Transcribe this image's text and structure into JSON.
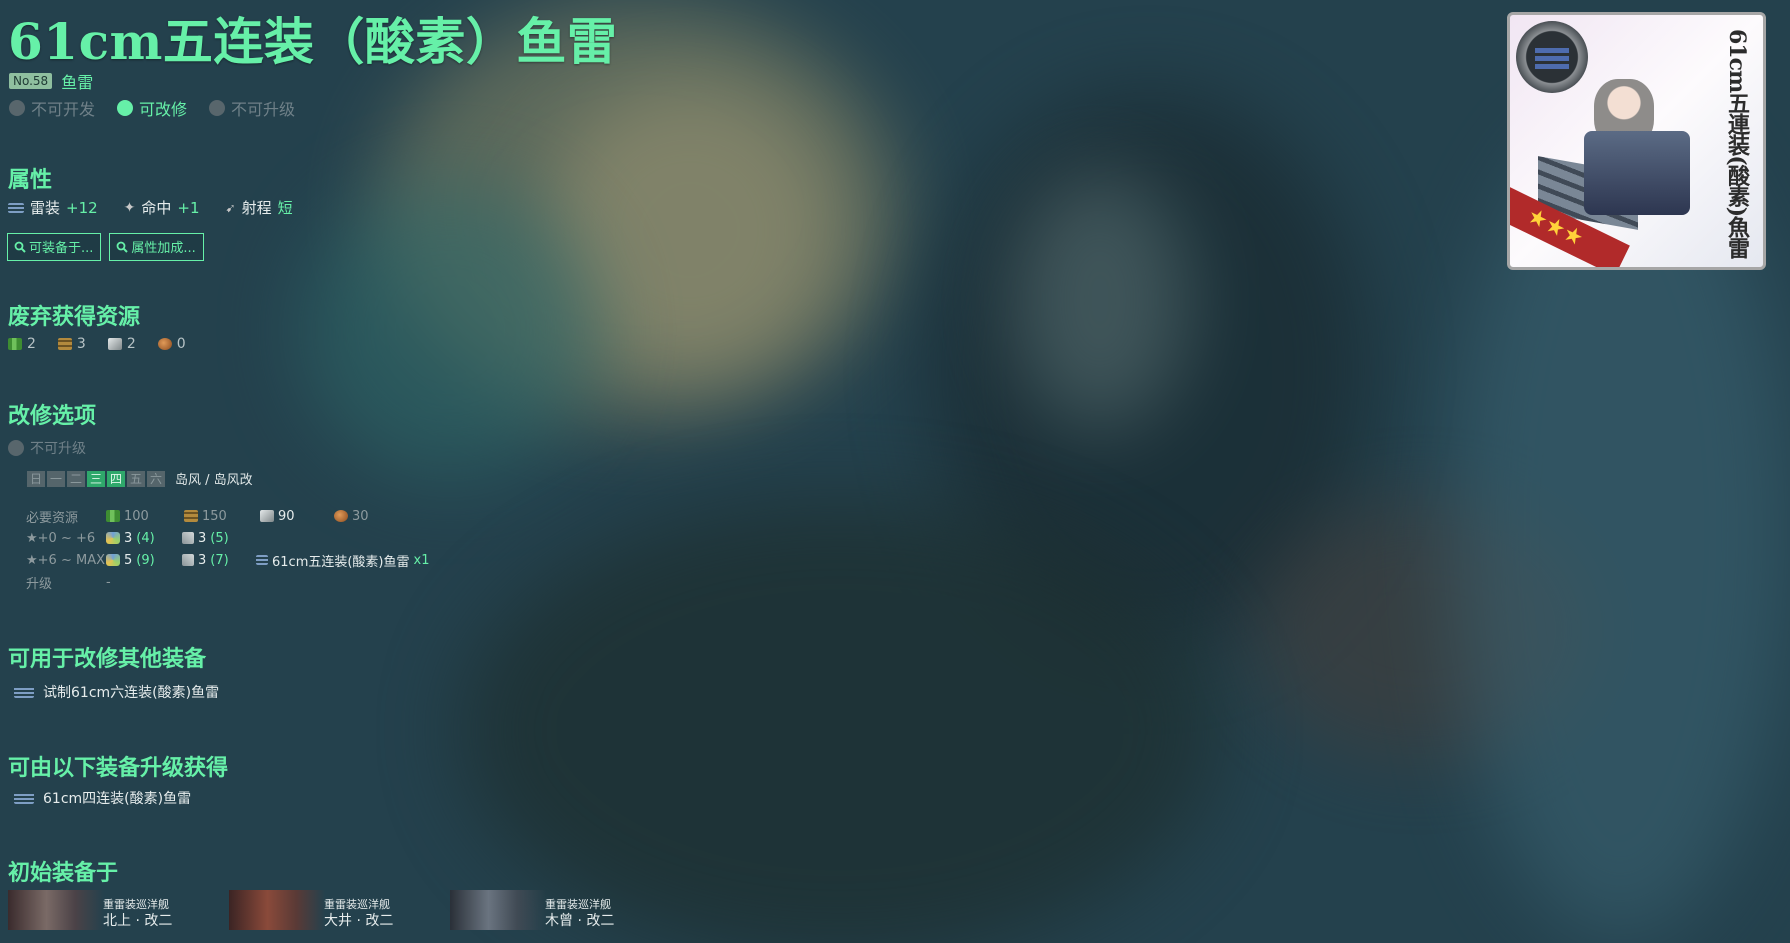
{
  "equipment": {
    "name": "61cm五连装（酸素）鱼雷",
    "number": "No.58",
    "type": "鱼雷"
  },
  "status": [
    {
      "label": "不可开发",
      "active": false
    },
    {
      "label": "可改修",
      "active": true
    },
    {
      "label": "不可升级",
      "active": false
    }
  ],
  "sections": {
    "attributes": "属性",
    "scrap": "废弃获得资源",
    "improvement": "改修选项",
    "used_for": "可用于改修其他装备",
    "upgraded_from": "可由以下装备升级获得",
    "initially_equipped": "初始装备于"
  },
  "stats": [
    {
      "icon": "torpedo-icon",
      "label": "雷装",
      "value": "+12"
    },
    {
      "icon": "accuracy-icon",
      "label": "命中",
      "value": "+1"
    },
    {
      "icon": "range-icon",
      "label": "射程",
      "value": "短"
    }
  ],
  "buttons": {
    "equippable": "可装备于...",
    "bonus": "属性加成..."
  },
  "scrap": [
    {
      "icon": "fuel-icon",
      "value": "2"
    },
    {
      "icon": "ammo-icon",
      "value": "3"
    },
    {
      "icon": "steel-icon",
      "value": "2"
    },
    {
      "icon": "bauxite-icon",
      "value": "0"
    }
  ],
  "improvement": {
    "no_upgrade": "不可升级",
    "days": [
      {
        "label": "日",
        "on": false
      },
      {
        "label": "一",
        "on": false
      },
      {
        "label": "二",
        "on": false
      },
      {
        "label": "三",
        "on": true
      },
      {
        "label": "四",
        "on": true
      },
      {
        "label": "五",
        "on": false
      },
      {
        "label": "六",
        "on": false
      }
    ],
    "ship": "岛风 / 岛风改",
    "rows": {
      "resources": {
        "label": "必要资源",
        "fuel": "100",
        "ammo": "150",
        "steel": "90",
        "bauxite": "30"
      },
      "stage1": {
        "label": "★+0 ~ +6",
        "dev": "3",
        "dev_sure": "(4)",
        "screw": "3",
        "screw_sure": "(5)"
      },
      "stage2": {
        "label": "★+6 ~ MAX",
        "dev": "5",
        "dev_sure": "(9)",
        "screw": "3",
        "screw_sure": "(7)",
        "item": "61cm五连装(酸素)鱼雷",
        "item_count": "x1"
      },
      "upgrade": {
        "label": "升级",
        "value": "-"
      }
    }
  },
  "used_for": [
    "试制61cm六连装(酸素)鱼雷"
  ],
  "upgraded_from": [
    "61cm四连装(酸素)鱼雷"
  ],
  "ships": [
    {
      "type": "重雷装巡洋舰",
      "name": "北上 · 改二"
    },
    {
      "type": "重雷装巡洋舰",
      "name": "大井 · 改二"
    },
    {
      "type": "重雷装巡洋舰",
      "name": "木曾 · 改二"
    }
  ],
  "card": {
    "vertical_name": "61cm五連装(酸素)魚雷",
    "stars": "★★★"
  },
  "colors": {
    "accent": "#66f0a8",
    "background": "#24414d",
    "inactive": "#58666c"
  }
}
